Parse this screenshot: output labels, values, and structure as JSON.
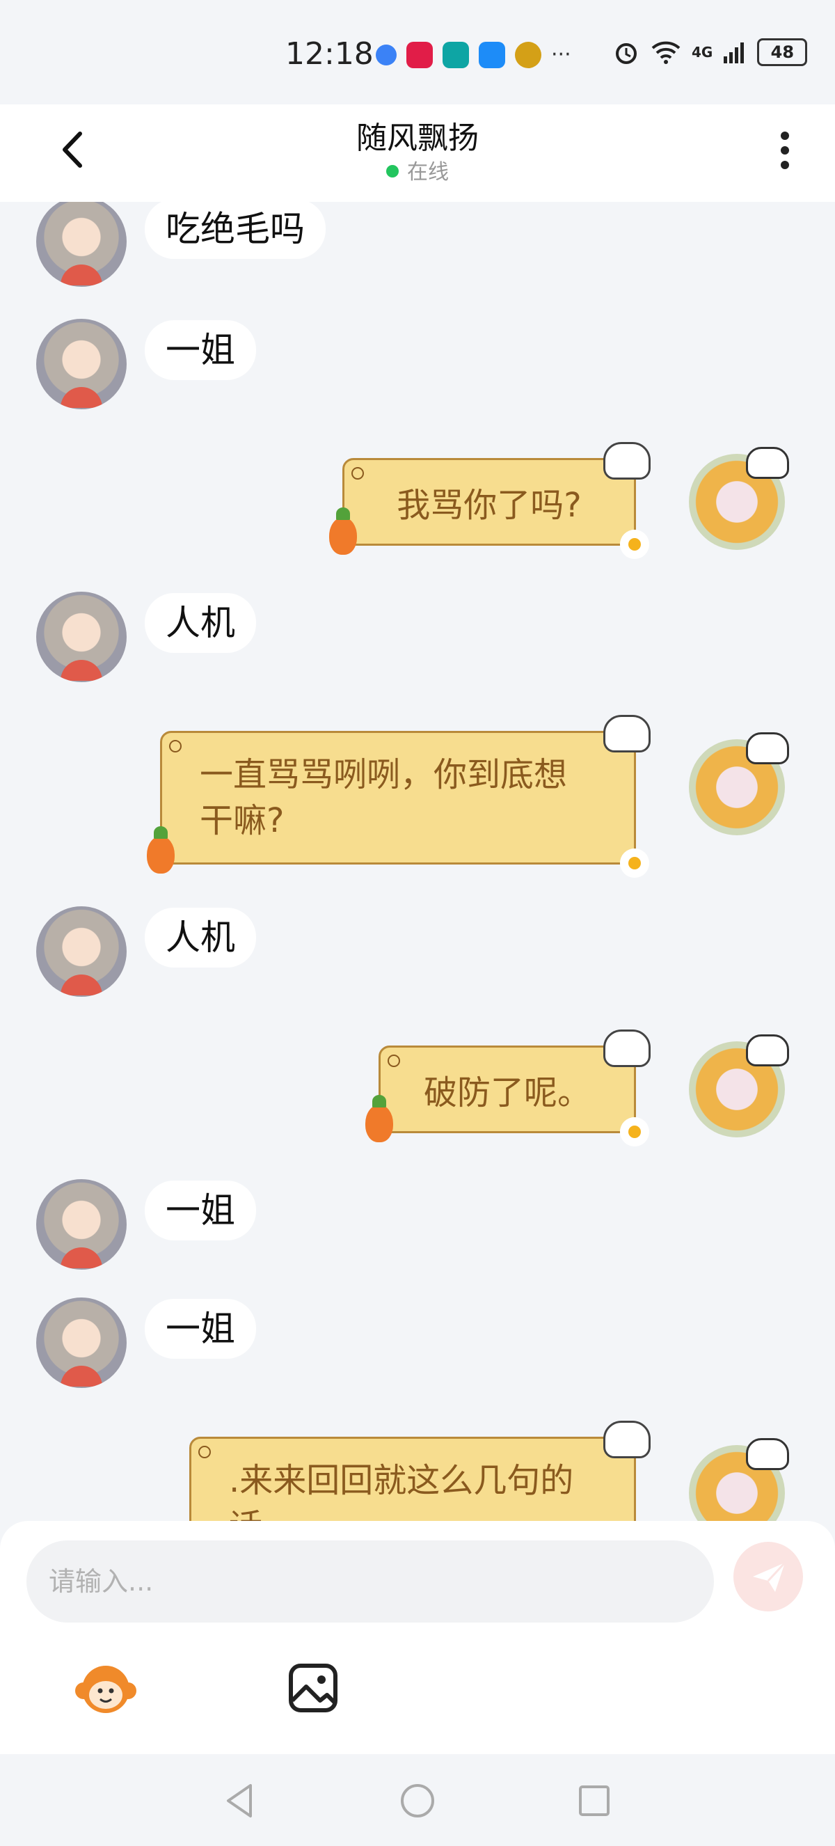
{
  "status_bar": {
    "time": "12:18",
    "network": "4G",
    "battery": "48"
  },
  "header": {
    "title": "随风飘扬",
    "status": "在线"
  },
  "messages": [
    {
      "side": "in",
      "text": "吃绝毛吗"
    },
    {
      "side": "in",
      "text": "一姐"
    },
    {
      "side": "out",
      "text": "我骂你了吗?"
    },
    {
      "side": "in",
      "text": "人机"
    },
    {
      "side": "out",
      "text": "一直骂骂咧咧，你到底想干嘛?"
    },
    {
      "side": "in",
      "text": "人机"
    },
    {
      "side": "out",
      "text": "破防了呢。"
    },
    {
      "side": "in",
      "text": "一姐"
    },
    {
      "side": "in",
      "text": "一姐"
    },
    {
      "side": "out",
      "text": ".来来回回就这么几句的话"
    }
  ],
  "input": {
    "placeholder": "请输入..."
  },
  "colors": {
    "accent_online": "#22c55e",
    "bubble_out_bg": "#f7dd8f",
    "bubble_out_text": "#8a5a1e",
    "send_button": "#fbe4e2"
  }
}
